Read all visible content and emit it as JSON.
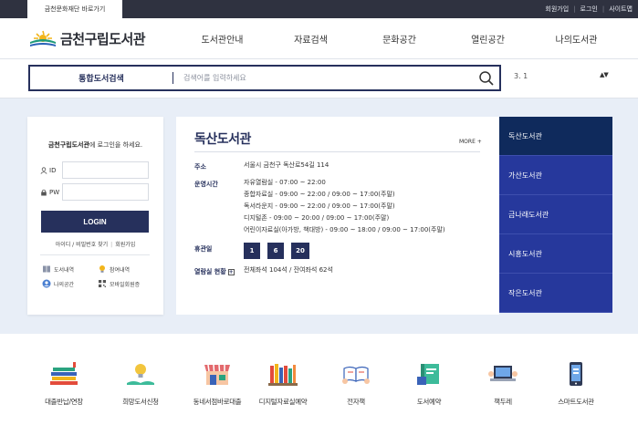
{
  "topbar": {
    "foundation_link": "금천문화재단 바로가기",
    "util_links": [
      "회원가입",
      "로그인",
      "사이트맵"
    ]
  },
  "header": {
    "logo_text": "금천구립도서관",
    "nav": [
      "도서관안내",
      "자료검색",
      "문화공간",
      "열린공간",
      "나의도서관"
    ]
  },
  "search": {
    "label": "통합도서검색",
    "placeholder": "검색어를 입력하세요",
    "notice": "3. 1",
    "notice_arrows": "▲▼"
  },
  "login": {
    "greeting_bold": "금천구립도서관",
    "greeting_rest": "에 로그인을 하세요.",
    "id_label": "ID",
    "pw_label": "PW",
    "login_button": "LOGIN",
    "find_link": "아이디 / 비밀번호 찾기",
    "join_link": "회원가입",
    "quick": [
      "도서내역",
      "참여내역",
      "나의공간",
      "모바일회원증"
    ]
  },
  "library_info": {
    "title": "독산도서관",
    "more": "MORE +",
    "address_label": "주소",
    "address": "서울시 금천구 독산로54길 114",
    "hours_label": "운영시간",
    "hours": [
      "자유열람실 - 07:00 ~ 22:00",
      "종합자료실 - 09:00 ~ 22:00 / 09:00 ~ 17:00(주말)",
      "독서라운지 - 09:00 ~ 22:00 / 09:00 ~ 17:00(주말)",
      "디지털존 - 09:00 ~ 20:00 / 09:00 ~ 17:00(주말)",
      "어린이자료실(아가방, 책대방) - 09:00 ~ 18:00 / 09:00 ~ 17:00(주말)"
    ],
    "holiday_label": "휴관일",
    "holidays": [
      "1",
      "6",
      "20"
    ],
    "seat_label": "열람실 현황",
    "seat_status": "전체좌석 104석 / 잔여좌석 62석"
  },
  "branches": [
    "독산도서관",
    "가산도서관",
    "금나래도서관",
    "시흥도서관",
    "작은도서관"
  ],
  "quick_menu": [
    "대출반납/연장",
    "희망도서신청",
    "동네서점바로대출",
    "디지털자료실예약",
    "전자책",
    "도서예약",
    "책두레",
    "스마트도서관"
  ]
}
